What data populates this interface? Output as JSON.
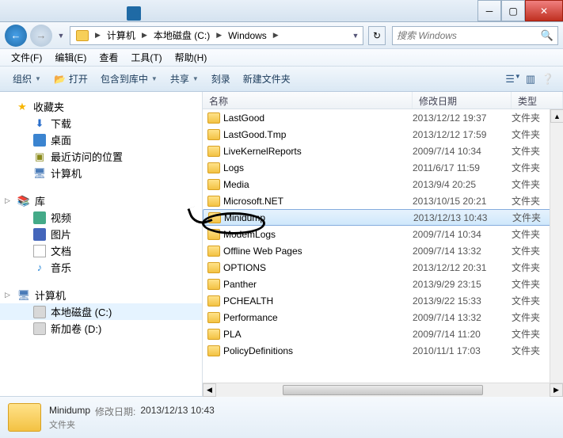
{
  "breadcrumb": {
    "segs": [
      "计算机",
      "本地磁盘 (C:)",
      "Windows"
    ]
  },
  "search": {
    "placeholder": "搜索 Windows"
  },
  "menus": {
    "file": "文件(F)",
    "edit": "编辑(E)",
    "view": "查看",
    "tools": "工具(T)",
    "help": "帮助(H)"
  },
  "toolbar": {
    "organize": "组织",
    "open": "打开",
    "include": "包含到库中",
    "share": "共享",
    "burn": "刻录",
    "newfolder": "新建文件夹"
  },
  "columns": {
    "name": "名称",
    "date": "修改日期",
    "type": "类型"
  },
  "type_folder": "文件夹",
  "sidebar": {
    "fav": {
      "label": "收藏夹",
      "items": [
        {
          "label": "下载",
          "icon": "i-dl",
          "glyph": "⬇"
        },
        {
          "label": "桌面",
          "icon": "i-desk",
          "glyph": ""
        },
        {
          "label": "最近访问的位置",
          "icon": "i-recent",
          "glyph": "▣"
        },
        {
          "label": "计算机",
          "icon": "i-comp",
          "glyph": "🖥"
        }
      ]
    },
    "lib": {
      "label": "库",
      "items": [
        {
          "label": "视频",
          "icon": "i-vid",
          "glyph": ""
        },
        {
          "label": "图片",
          "icon": "i-pic",
          "glyph": ""
        },
        {
          "label": "文档",
          "icon": "i-doc",
          "glyph": ""
        },
        {
          "label": "音乐",
          "icon": "i-mus",
          "glyph": "♪"
        }
      ]
    },
    "comp": {
      "label": "计算机",
      "items": [
        {
          "label": "本地磁盘 (C:)",
          "icon": "i-drive",
          "glyph": ""
        },
        {
          "label": "新加卷 (D:)",
          "icon": "i-drive",
          "glyph": ""
        }
      ]
    }
  },
  "rows": [
    {
      "name": "LastGood",
      "date": "2013/12/12 19:37",
      "sel": false
    },
    {
      "name": "LastGood.Tmp",
      "date": "2013/12/12 17:59",
      "sel": false
    },
    {
      "name": "LiveKernelReports",
      "date": "2009/7/14 10:34",
      "sel": false
    },
    {
      "name": "Logs",
      "date": "2011/6/17 11:59",
      "sel": false
    },
    {
      "name": "Media",
      "date": "2013/9/4 20:25",
      "sel": false
    },
    {
      "name": "Microsoft.NET",
      "date": "2013/10/15 20:21",
      "sel": false
    },
    {
      "name": "Minidump",
      "date": "2013/12/13 10:43",
      "sel": true
    },
    {
      "name": "ModemLogs",
      "date": "2009/7/14 10:34",
      "sel": false
    },
    {
      "name": "Offline Web Pages",
      "date": "2009/7/14 13:32",
      "sel": false
    },
    {
      "name": "OPTIONS",
      "date": "2013/12/12 20:31",
      "sel": false
    },
    {
      "name": "Panther",
      "date": "2013/9/29 23:15",
      "sel": false
    },
    {
      "name": "PCHEALTH",
      "date": "2013/9/22 15:33",
      "sel": false
    },
    {
      "name": "Performance",
      "date": "2009/7/14 13:32",
      "sel": false
    },
    {
      "name": "PLA",
      "date": "2009/7/14 11:20",
      "sel": false
    },
    {
      "name": "PolicyDefinitions",
      "date": "2010/11/1 17:03",
      "sel": false
    }
  ],
  "details": {
    "name": "Minidump",
    "date_label": "修改日期:",
    "date": "2013/12/13 10:43",
    "type": "文件夹"
  }
}
